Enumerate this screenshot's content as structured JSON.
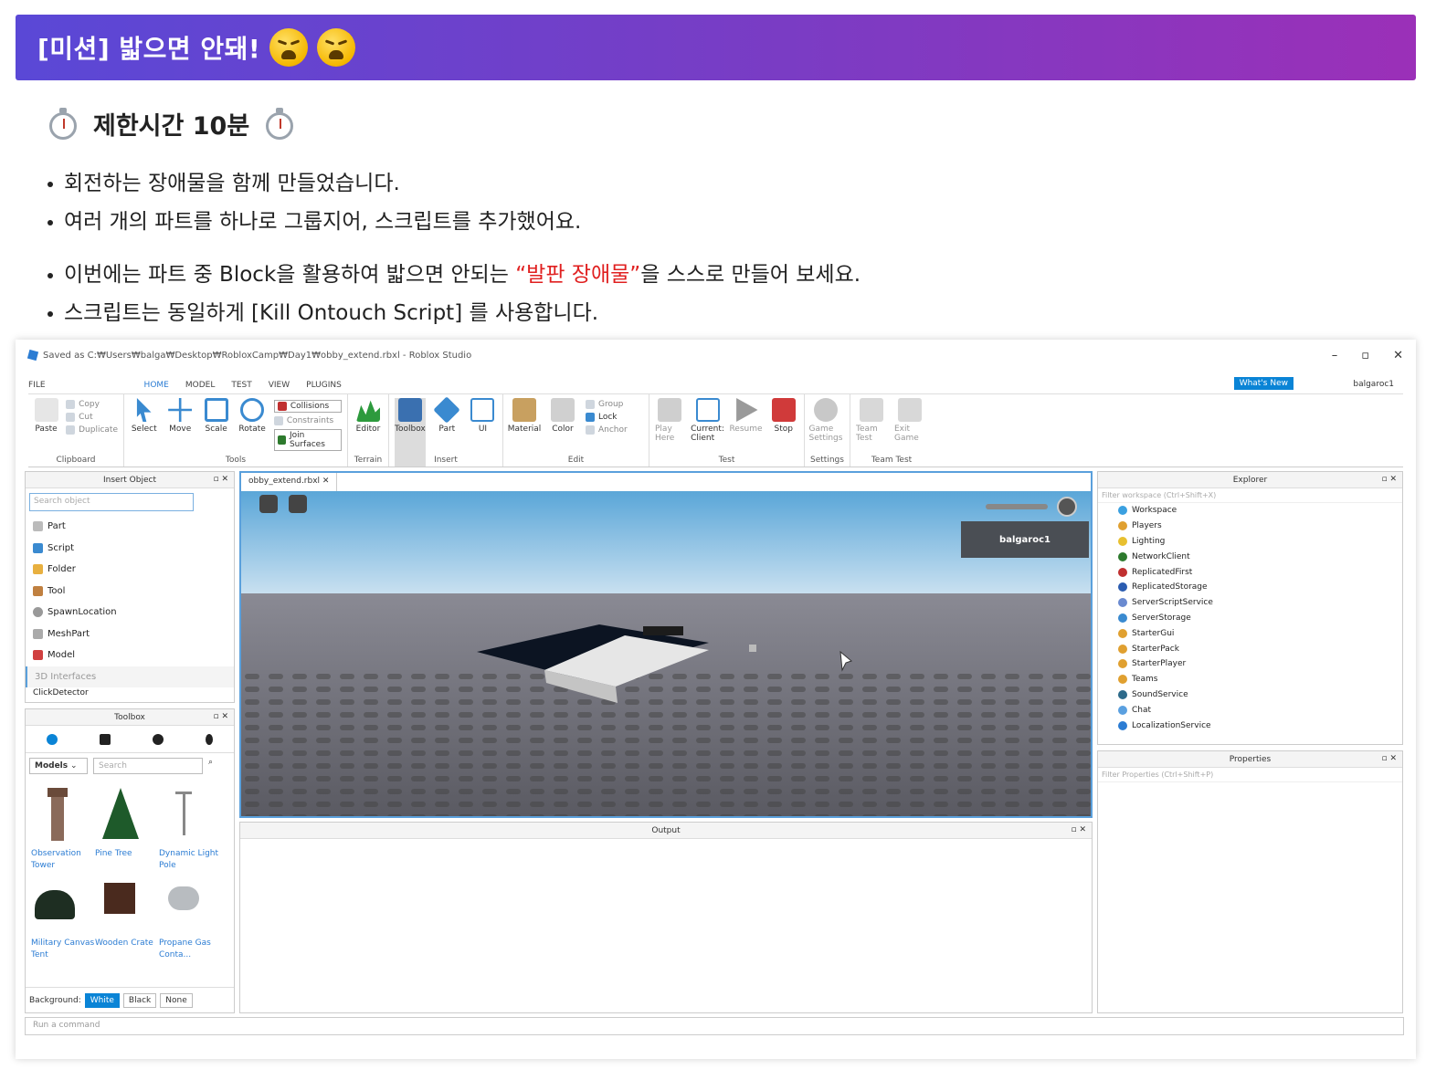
{
  "banner": {
    "title": "[미션] 밟으면 안돼!"
  },
  "subtitle": "제한시간 10분",
  "bullets_a": [
    "회전하는 장애물을 함께 만들었습니다.",
    "여러 개의 파트를 하나로 그룹지어, 스크립트를 추가했어요."
  ],
  "bullet_b1": {
    "before": "이번에는 파트 중 Block을 활용하여 밟으면 안되는 ",
    "highlight": "“발판 장애물”",
    "after": "을 스스로 만들어 보세요."
  },
  "bullet_b2": "스크립트는 동일하게 [Kill Ontouch Script] 를 사용합니다.",
  "studio": {
    "title": "Saved as C:₩Users₩balga₩Desktop₩RobloxCamp₩Day1₩obby_extend.rbxl - Roblox Studio",
    "menu": [
      "FILE",
      "HOME",
      "MODEL",
      "TEST",
      "VIEW",
      "PLUGINS"
    ],
    "whats_new": "What's New",
    "user": "balgaroc1",
    "ribbon": {
      "clipboard": {
        "label": "Clipboard",
        "paste": "Paste",
        "copy": "Copy",
        "cut": "Cut",
        "duplicate": "Duplicate"
      },
      "tools": {
        "label": "Tools",
        "select": "Select",
        "move": "Move",
        "scale": "Scale",
        "rotate": "Rotate",
        "collisions": "Collisions",
        "constraints": "Constraints",
        "join": "Join Surfaces"
      },
      "terrain": {
        "label": "Terrain",
        "editor": "Editor"
      },
      "insert": {
        "label": "Insert",
        "toolbox": "Toolbox",
        "part": "Part",
        "ui": "UI"
      },
      "edit": {
        "label": "Edit",
        "material": "Material",
        "color": "Color",
        "group": "Group",
        "lock": "Lock",
        "anchor": "Anchor"
      },
      "test": {
        "label": "Test",
        "play": "Play Here",
        "current": "Current: Client",
        "resume": "Resume",
        "stop": "Stop"
      },
      "settings": {
        "label": "Settings",
        "game": "Game Settings"
      },
      "teamtest": {
        "label": "Team Test",
        "team": "Team Test",
        "exit": "Exit Game"
      }
    },
    "insert_object": {
      "title": "Insert Object",
      "placeholder": "Search object",
      "items": [
        "Part",
        "Script",
        "Folder",
        "Tool",
        "SpawnLocation",
        "MeshPart",
        "Model"
      ],
      "section": "3D Interfaces",
      "cut_item": "ClickDetector"
    },
    "toolbox": {
      "title": "Toolbox",
      "category": "Models",
      "search": "Search",
      "items": [
        {
          "name": "Observation Tower"
        },
        {
          "name": "Pine Tree"
        },
        {
          "name": "Dynamic Light Pole"
        },
        {
          "name": "Military Canvas Tent"
        },
        {
          "name": "Wooden Crate"
        },
        {
          "name": "Propane Gas Conta..."
        }
      ],
      "background_label": "Background:",
      "bg_options": [
        "White",
        "Black",
        "None"
      ]
    },
    "viewport": {
      "tab": "obby_extend.rbxl",
      "player": "balgaroc1"
    },
    "output": {
      "title": "Output"
    },
    "explorer": {
      "title": "Explorer",
      "filter": "Filter workspace (Ctrl+Shift+X)",
      "items": [
        "Workspace",
        "Players",
        "Lighting",
        "NetworkClient",
        "ReplicatedFirst",
        "ReplicatedStorage",
        "ServerScriptService",
        "ServerStorage",
        "StarterGui",
        "StarterPack",
        "StarterPlayer",
        "Teams",
        "SoundService",
        "Chat",
        "LocalizationService"
      ],
      "colors": [
        "#3aa0e0",
        "#e0a030",
        "#e8c030",
        "#2d7a2d",
        "#c03030",
        "#2b5cb0",
        "#6a8ad0",
        "#3a8ad0",
        "#e0a030",
        "#e0a030",
        "#e0a030",
        "#e0a030",
        "#2d6a8a",
        "#5aa0e0",
        "#2b7cd3"
      ]
    },
    "properties": {
      "title": "Properties",
      "filter": "Filter Properties (Ctrl+Shift+P)"
    },
    "command": {
      "placeholder": "Run a command"
    }
  }
}
